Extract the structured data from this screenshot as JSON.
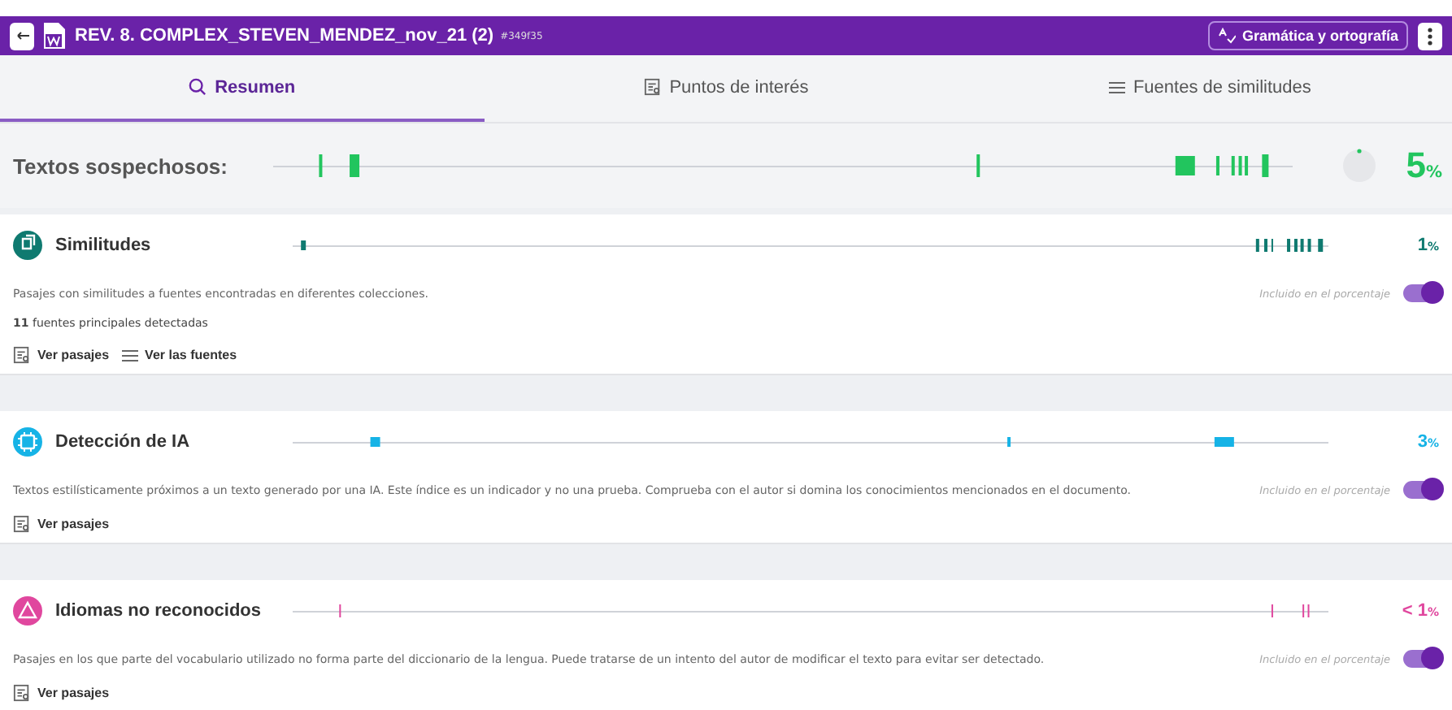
{
  "header": {
    "title": "REV. 8. COMPLEX_STEVEN_MENDEZ_nov_21 (2)",
    "id": "#349f35",
    "grammar_button": "Gramática y ortografía"
  },
  "tabs": [
    {
      "label": "Resumen",
      "kind": "search",
      "selected": true
    },
    {
      "label": "Puntos de interés",
      "kind": "passages",
      "selected": false
    },
    {
      "label": "Fuentes de similitudes",
      "kind": "list",
      "selected": false
    }
  ],
  "summary": {
    "label": "Textos sospechosos:",
    "value": "5",
    "unit": "%",
    "color": "#22c55e"
  },
  "sections": [
    {
      "kind": "similarity",
      "title": "Similitudes",
      "color": "#0f7a70",
      "value": "1",
      "unit": "%",
      "description": "Pasajes con similitudes a fuentes encontradas en diferentes colecciones.",
      "detail": "**11** fuentes principales detectadas",
      "toggle_label": "Incluido en el porcentaje",
      "included": true,
      "links": [
        {
          "label": "Ver pasajes",
          "kind": "passages"
        },
        {
          "label": "Ver las fuentes",
          "kind": "list"
        }
      ]
    },
    {
      "kind": "ai",
      "title": "Detección de IA",
      "color": "#16b3e6",
      "value": "3",
      "unit": "%",
      "description": "Textos estilísticamente próximos a un texto generado por una IA. Este índice es un indicador y no una prueba. Comprueba con el autor si domina los conocimientos mencionados en el documento.",
      "toggle_label": "Incluido en el porcentaje",
      "included": true,
      "links": [
        {
          "label": "Ver pasajes",
          "kind": "passages"
        }
      ]
    },
    {
      "kind": "language",
      "title": "Idiomas no reconocidos",
      "color": "#e0479e",
      "value": "< 1",
      "unit": "%",
      "description": "Pasajes en los que parte del vocabulario utilizado no forma parte del diccionario de la lengua. Puede tratarse de un intento del autor de modificar el texto para evitar ser detectado.",
      "toggle_label": "Incluido en el porcentaje",
      "included": true,
      "links": [
        {
          "label": "Ver pasajes",
          "kind": "passages"
        }
      ]
    }
  ]
}
